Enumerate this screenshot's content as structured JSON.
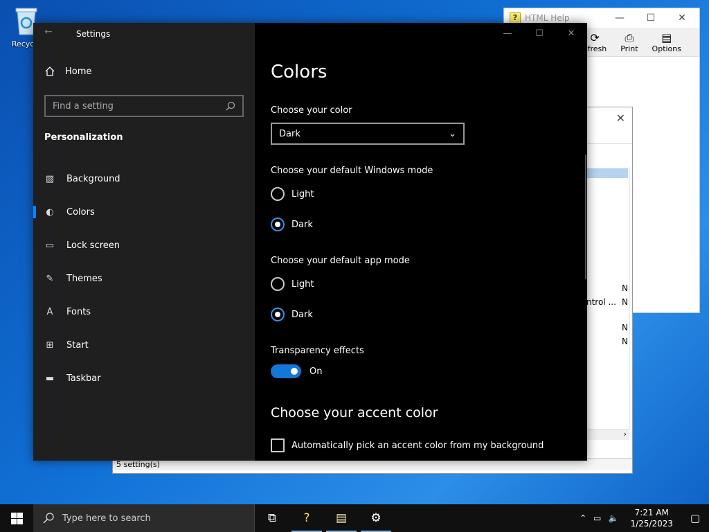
{
  "desktop": {
    "recycle_label": "Recycle"
  },
  "help_window": {
    "title": "HTML Help",
    "toolbar": [
      {
        "label": "efresh",
        "icon": "refresh-icon"
      },
      {
        "label": "Print",
        "icon": "printer-icon"
      },
      {
        "label": "Options",
        "icon": "options-icon"
      }
    ]
  },
  "control_panel": {
    "cells": [
      "N",
      "ntrol ...",
      "N",
      "N",
      "N"
    ],
    "status": "5 setting(s)"
  },
  "settings": {
    "title": "Settings",
    "home_label": "Home",
    "search_placeholder": "Find a setting",
    "section": "Personalization",
    "nav": [
      {
        "label": "Background",
        "icon": "picture-icon"
      },
      {
        "label": "Colors",
        "icon": "palette-icon"
      },
      {
        "label": "Lock screen",
        "icon": "lock-screen-icon"
      },
      {
        "label": "Themes",
        "icon": "themes-icon"
      },
      {
        "label": "Fonts",
        "icon": "fonts-icon"
      },
      {
        "label": "Start",
        "icon": "start-icon"
      },
      {
        "label": "Taskbar",
        "icon": "taskbar-icon"
      }
    ],
    "page_title": "Colors",
    "choose_color_label": "Choose your color",
    "choose_color_value": "Dark",
    "windows_mode_label": "Choose your default Windows mode",
    "windows_mode_light": "Light",
    "windows_mode_dark": "Dark",
    "app_mode_label": "Choose your default app mode",
    "app_mode_light": "Light",
    "app_mode_dark": "Dark",
    "transparency_label": "Transparency effects",
    "transparency_value": "On",
    "accent_heading": "Choose your accent color",
    "auto_accent_label": "Automatically pick an accent color from my background"
  },
  "taskbar": {
    "search_placeholder": "Type here to search",
    "time": "7:21 AM",
    "date": "1/25/2023"
  },
  "colors": {
    "accent": "#0078d7",
    "window_bg": "#000000",
    "nav_bg": "#1f1f1f"
  }
}
